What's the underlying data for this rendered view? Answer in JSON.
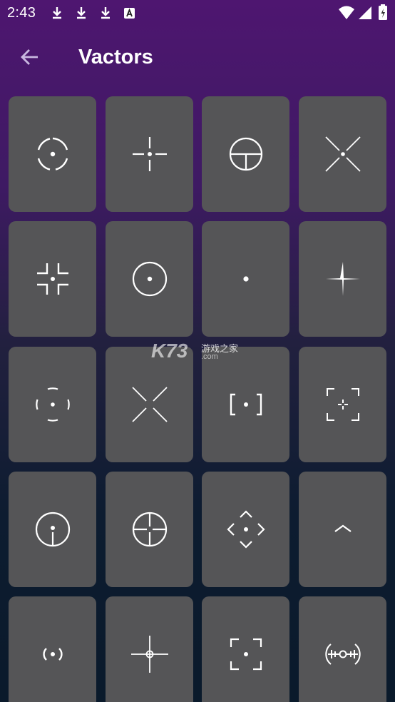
{
  "status_bar": {
    "time": "2:43",
    "left_icons": [
      "download-icon",
      "download-icon",
      "download-icon",
      "font-icon"
    ],
    "right_icons": [
      "wifi-icon",
      "signal-icon",
      "battery-icon"
    ]
  },
  "app_bar": {
    "title": "Vactors",
    "back_icon": "arrow-left-icon"
  },
  "watermark": {
    "logo": "K73",
    "cn": "游戏之家",
    "domain": ".com"
  },
  "crosshairs": [
    "crosshair-broken-circle-dot",
    "crosshair-gap-cross-dot",
    "crosshair-circle-t",
    "crosshair-diagonal-x-dot",
    "crosshair-corner-brackets-dot",
    "crosshair-circle-dot",
    "crosshair-dot",
    "crosshair-thin-star",
    "crosshair-four-arcs-dot",
    "crosshair-diagonal-x",
    "crosshair-brackets-dot",
    "crosshair-square-corners-cross",
    "crosshair-circle-vertical-dot",
    "crosshair-circle-cross-gaps",
    "crosshair-diamond-chevrons-dot",
    "crosshair-chevron-up",
    "crosshair-parens-dot",
    "crosshair-cross-small-circle",
    "crosshair-square-corners-dot",
    "crosshair-rangefinder"
  ],
  "colors": {
    "tile_bg": "#555557",
    "icon": "#ffffff"
  }
}
